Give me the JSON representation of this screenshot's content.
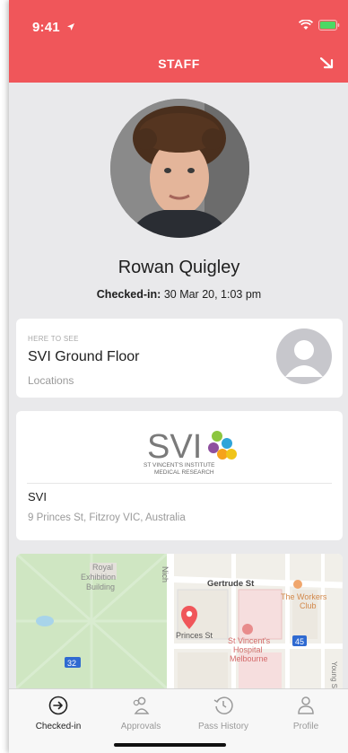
{
  "status": {
    "time": "9:41"
  },
  "header": {
    "title": "STAFF"
  },
  "visitor": {
    "name": "Rowan Quigley",
    "checked_label": "Checked-in:",
    "checked_value": "30 Mar 20, 1:03 pm"
  },
  "host_card": {
    "label": "HERE TO SEE",
    "title": "SVI Ground Floor",
    "subtitle": "Locations"
  },
  "site_card": {
    "logo_main": "SVI",
    "logo_line1": "ST VINCENT'S INSTITUTE",
    "logo_line2": "MEDICAL RESEARCH",
    "name": "SVI",
    "address": "9 Princes St, Fitzroy VIC, Australia"
  },
  "map": {
    "labels": {
      "royal": "Royal",
      "exhibition": "Exhibition",
      "building": "Building",
      "nich": "Nich",
      "gertrude": "Gertrude St",
      "workers1": "The Workers",
      "workers2": "Club",
      "princes": "Princes St",
      "hosp1": "St Vincent's",
      "hosp2": "Hospital",
      "hosp3": "Melbourne",
      "route45": "45",
      "route32": "32",
      "young": "Young St"
    }
  },
  "tabs": [
    {
      "label": "Checked-in",
      "icon": "arrow-circle-icon"
    },
    {
      "label": "Approvals",
      "icon": "users-icon"
    },
    {
      "label": "Pass History",
      "icon": "history-icon"
    },
    {
      "label": "Profile",
      "icon": "person-icon"
    }
  ],
  "colors": {
    "accent": "#f0565a",
    "background": "#e9e9eb"
  }
}
